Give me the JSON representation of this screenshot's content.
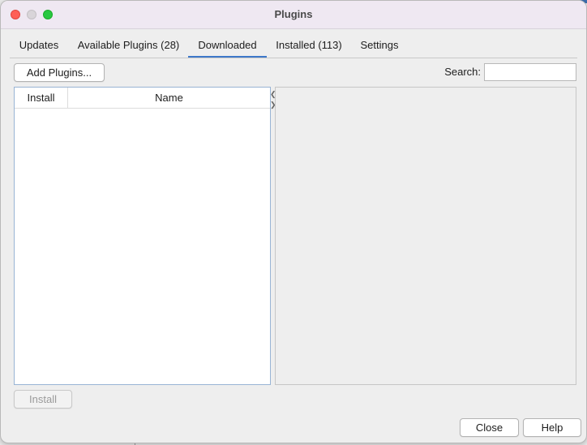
{
  "window": {
    "title": "Plugins"
  },
  "tabs": [
    {
      "label": "Updates"
    },
    {
      "label": "Available Plugins (28)"
    },
    {
      "label": "Downloaded",
      "active": true
    },
    {
      "label": "Installed (113)"
    },
    {
      "label": "Settings"
    }
  ],
  "toolbar": {
    "add_plugins_label": "Add Plugins...",
    "search_label": "Search:",
    "search_value": ""
  },
  "table": {
    "columns": [
      "Install",
      "Name"
    ],
    "rows": []
  },
  "footer": {
    "install_label": "Install",
    "close_label": "Close",
    "help_label": "Help"
  },
  "colors": {
    "accent": "#3d78c9",
    "close_light": "#fe5f57",
    "max_light": "#28c840"
  }
}
